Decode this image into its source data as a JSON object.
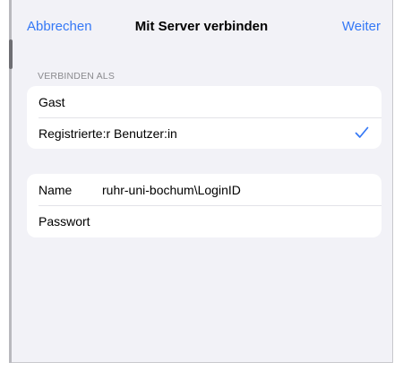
{
  "nav": {
    "cancel_label": "Abbrechen",
    "title": "Mit Server verbinden",
    "next_label": "Weiter"
  },
  "connect_as": {
    "header": "VERBINDEN ALS",
    "options": [
      {
        "label": "Gast",
        "selected": false
      },
      {
        "label": "Registrierte:r Benutzer:in",
        "selected": true
      }
    ]
  },
  "credentials": {
    "name_label": "Name",
    "name_value": "ruhr-uni-bochum\\LoginID",
    "password_label": "Passwort",
    "password_value": ""
  },
  "colors": {
    "accent": "#3478f6",
    "background": "#f2f2f7",
    "section_header": "#8a8a8e"
  },
  "icons": {
    "selected_indicator": "checkmark-icon"
  }
}
